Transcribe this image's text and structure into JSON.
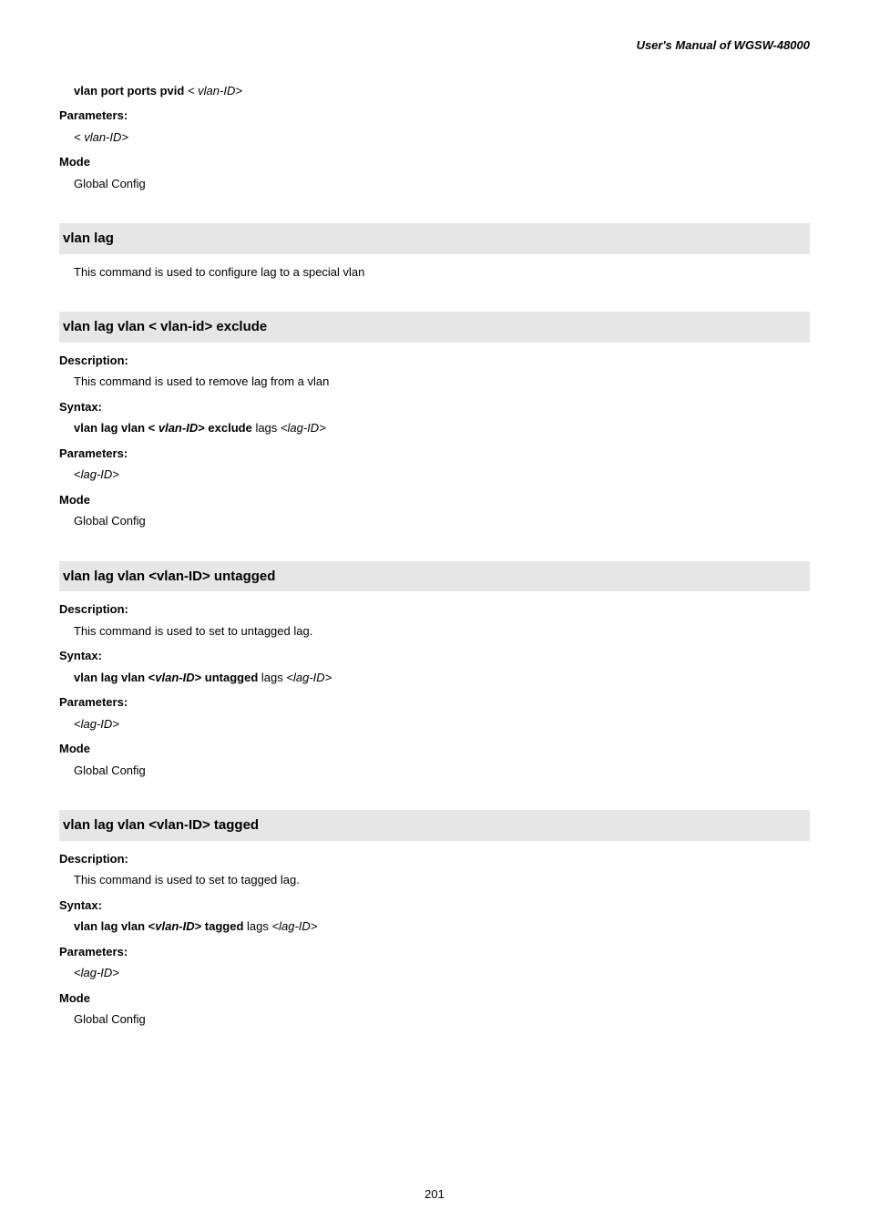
{
  "header": "User's Manual of WGSW-48000",
  "pageNumber": "201",
  "intro": {
    "syntaxLine_bold": "vlan port ports pvid ",
    "syntaxLine_rest": "< vlan-ID>",
    "paramLabel": "Parameters:",
    "paramVal": "< vlan-ID>",
    "modeLabel": "Mode",
    "modeVal": "Global Config"
  },
  "s1": {
    "heading": "vlan lag",
    "descText": "This command is used to configure lag to a special vlan"
  },
  "s2": {
    "heading": "vlan lag vlan < vlan-id> exclude",
    "descLabel": "Description:",
    "descText": "This command is used to remove lag from a vlan",
    "synLabel": "Syntax:",
    "syn_b1": "vlan lag vlan < ",
    "syn_bi": "vlan-ID",
    "syn_b2": "> exclude ",
    "syn_r1": "lags ",
    "syn_i": "<lag-ID>",
    "paramLabel": "Parameters:",
    "paramVal": "<lag-ID>",
    "modeLabel": "Mode",
    "modeVal": "Global Config"
  },
  "s3": {
    "heading": "vlan lag vlan <vlan-ID> untagged",
    "descLabel": "Description:",
    "descText": "This command is used to set to untagged lag.",
    "synLabel": "Syntax:",
    "syn_b1": "vlan lag vlan <",
    "syn_bi": "vlan-ID",
    "syn_b2": "> untagged ",
    "syn_r1": "lags ",
    "syn_i": "<lag-ID>",
    "paramLabel": "Parameters:",
    "paramVal": "<lag-ID>",
    "modeLabel": "Mode",
    "modeVal": "Global Config"
  },
  "s4": {
    "heading": "vlan lag vlan <vlan-ID> tagged",
    "descLabel": "Description:",
    "descText": "This command is used to set to tagged lag.",
    "synLabel": "Syntax:",
    "syn_b1": "vlan lag vlan <",
    "syn_bi": "vlan-ID",
    "syn_b2": "> tagged ",
    "syn_r1": "lags ",
    "syn_i": "<lag-ID>",
    "paramLabel": "Parameters:",
    "paramVal": "<lag-ID>",
    "modeLabel": "Mode",
    "modeVal": "Global Config"
  }
}
